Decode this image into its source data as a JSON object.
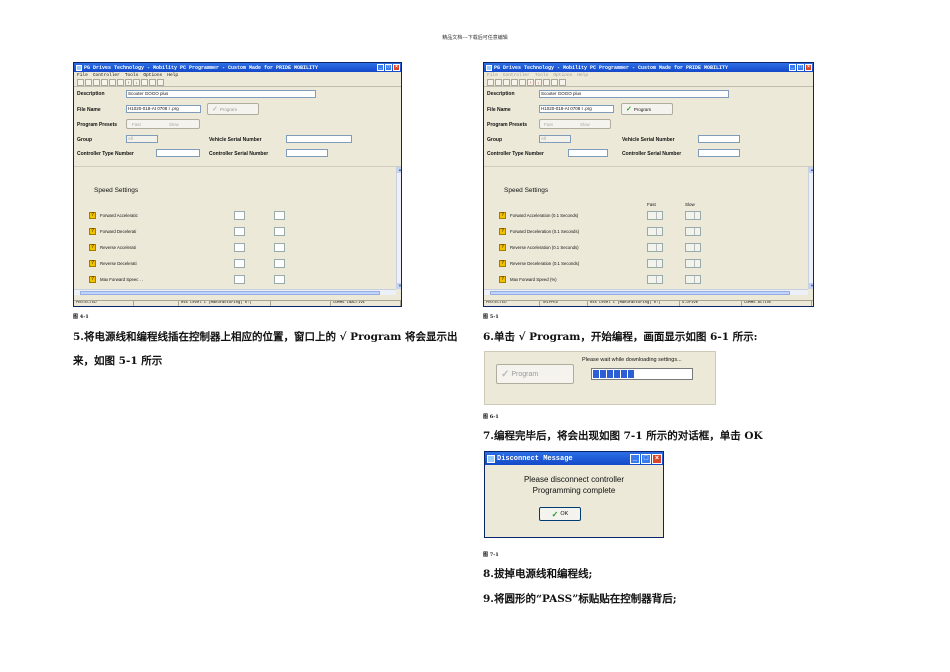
{
  "page_header": "精品文档---下载后可任意编辑",
  "window": {
    "title": "PG Drives Technology - Mobility PC Programmer - Custom Made for PRIDE MOBILITY",
    "menu": [
      "File",
      "Controller",
      "Tools",
      "Options",
      "Help"
    ],
    "labels": {
      "description": "Description",
      "file_name": "File Name",
      "program_presets": "Program Presets",
      "group": "Group",
      "vehicle_serial": "Vehicle Serial Number",
      "controller_type": "Controller Type Number",
      "controller_serial": "Controller Serial Number",
      "speed_settings": "Speed Settings",
      "fast": "Fast",
      "slow": "Slow",
      "program_button": "Program",
      "radio_fast": "Fast",
      "radio_slow": "Slow"
    },
    "values": {
      "description": "Scooter GOGO plus",
      "file_name": "H1020-018-At 0708 I .prg",
      "group": "All"
    }
  },
  "fig41": {
    "rows": [
      "Forward Acceleratic",
      "Forward Decelerati",
      "Reverse Accelerati",
      "Reverse Decelerati",
      "Max Forward Speec . ."
    ],
    "status": [
      "PROTECTED",
      "",
      "ess Level C (Manufacturing)  0:(",
      "",
      "COMMS INACTIVE"
    ]
  },
  "fig51": {
    "rows": [
      "Forward Acceleration (0.1 Seconds)",
      "Forward Deceleration (0.1 Seconds)",
      "Reverse Acceleration (0.1 Seconds)",
      "Reverse Deceleration (0.1 Seconds)",
      "Max Forward Speed (%)"
    ],
    "status": [
      "PROTECTED",
      "TRIPPED",
      "ess Level C (Manufacturing)  0:(",
      "S-Drive",
      "COMMS ACTIVE"
    ]
  },
  "captions": {
    "fig41": "图 4-1",
    "fig51": "图 5-1",
    "fig61": "图 6-1",
    "fig71": "图 7-1"
  },
  "text": {
    "step5_line1": "5.将电源线和编程线插在控制器上相应的位置，窗口上的 √ Program 将会显示出",
    "step5_line2": "来，如图 5-1 所示",
    "step6": "6.单击 √ Program，开始编程，画面显示如图 6-1 所示:",
    "step7": "7.编程完毕后，将会出现如图 7-1 所示的对话框，单击 OK",
    "step8": "8.拔掉电源线和编程线;",
    "step9": "9.将圆形的“PASS”标贴贴在控制器背后;"
  },
  "download": {
    "message": "Please wait while downloading settings...",
    "program_label": "Program",
    "progress_percent": 40
  },
  "dialog": {
    "title": "Disconnect Message",
    "line1": "Please disconnect controller",
    "line2": "Programming complete",
    "ok_label": "OK"
  }
}
